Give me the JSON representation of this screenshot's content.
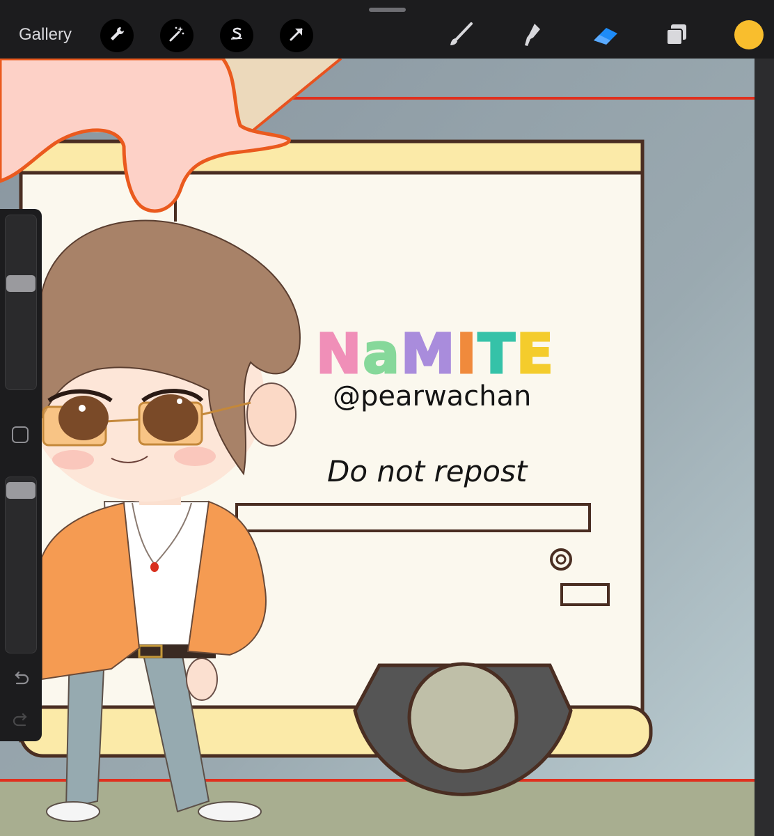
{
  "toolbar": {
    "gallery_label": "Gallery",
    "left_tools": [
      {
        "name": "wrench-icon"
      },
      {
        "name": "magic-wand-icon"
      },
      {
        "name": "selection-s-icon"
      },
      {
        "name": "transform-arrow-icon"
      }
    ],
    "right_tools": [
      {
        "name": "brush-icon"
      },
      {
        "name": "smudge-icon"
      },
      {
        "name": "eraser-icon",
        "active": true
      },
      {
        "name": "layers-icon"
      }
    ],
    "current_color": "#f9be2d",
    "active_tool_color": "#1e8bf7"
  },
  "sidebar": {
    "brush_size_level": 0.62,
    "opacity_level": 0.97,
    "undo_icon": "undo-icon",
    "redo_icon": "redo-icon"
  },
  "artwork": {
    "title_letters": [
      {
        "char": "N",
        "color": "#f08fb8"
      },
      {
        "char": "a",
        "color": "#86d89a"
      },
      {
        "char": "M",
        "color": "#a98cdc"
      },
      {
        "char": "I",
        "color": "#f08a3c"
      },
      {
        "char": "T",
        "color": "#35c2a8"
      },
      {
        "char": "E",
        "color": "#f4cc2c"
      }
    ],
    "handle": "@pearwachan",
    "notice": "Do not repost"
  }
}
